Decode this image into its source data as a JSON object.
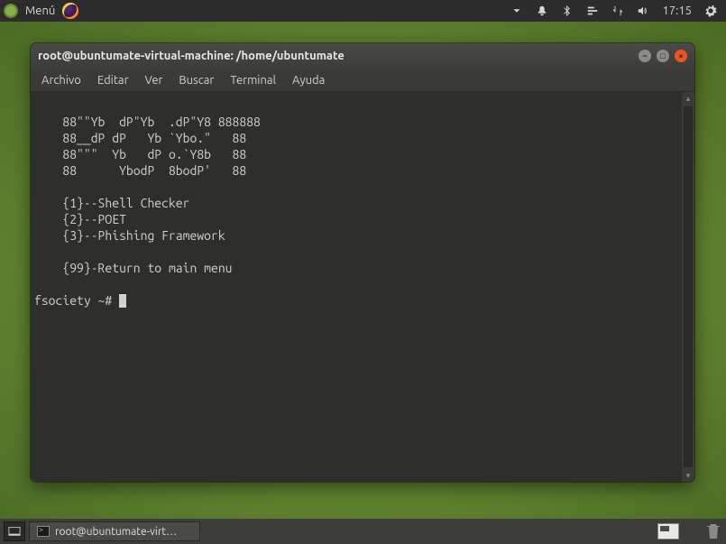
{
  "top_panel": {
    "menu_label": "Menú",
    "clock": "17:15"
  },
  "window": {
    "title": "root@ubuntumate-virtual-machine: /home/ubuntumate",
    "menubar": [
      "Archivo",
      "Editar",
      "Ver",
      "Buscar",
      "Terminal",
      "Ayuda"
    ]
  },
  "terminal": {
    "ascii_art": [
      "    88\"\"Yb  dP\"Yb  .dP\"Y8 888888",
      "    88__dP dP   Yb `Ybo.\"   88",
      "    88\"\"\"  Yb   dP o.`Y8b   88",
      "    88      YbodP  8bodP'   88"
    ],
    "menu_lines": [
      "    {1}--Shell Checker",
      "    {2}--POET",
      "    {3}--Phishing Framework",
      "",
      "    {99}-Return to main menu"
    ],
    "prompt": "fsociety ~# "
  },
  "taskbar": {
    "item_label": "root@ubuntumate-virt…"
  }
}
